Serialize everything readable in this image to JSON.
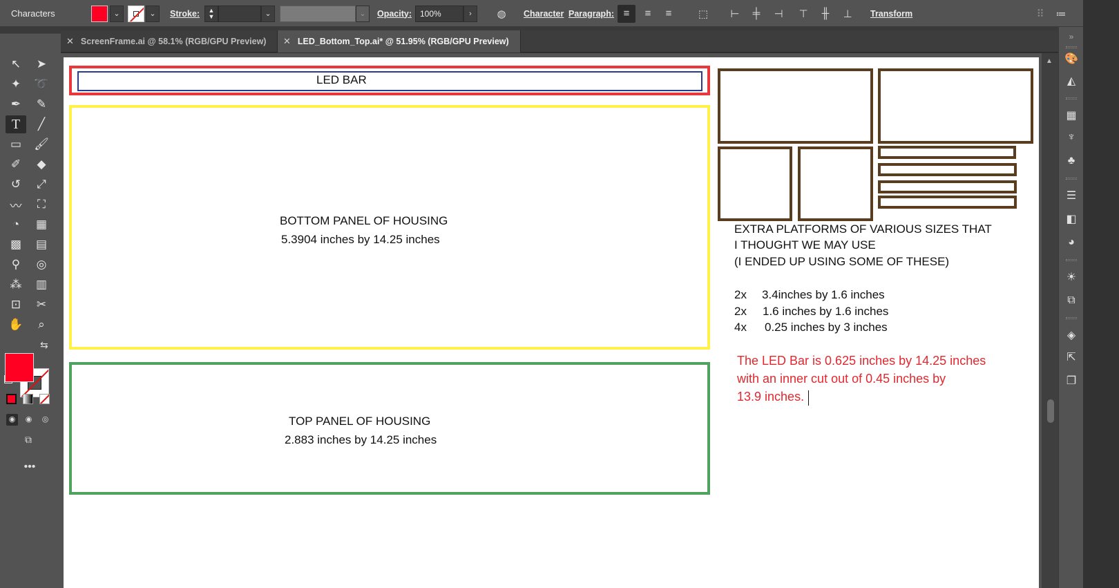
{
  "control_bar": {
    "panel_name": "Characters",
    "stroke_label": "Stroke:",
    "opacity_label": "Opacity:",
    "opacity_value": "100%",
    "character_link": "Character",
    "paragraph_link": "Paragraph:",
    "transform_link": "Transform",
    "fill_color": "#ff0022"
  },
  "tabs": [
    {
      "label": "ScreenFrame.ai @ 58.1% (RGB/GPU Preview)",
      "active": false
    },
    {
      "label": "LED_Bottom_Top.ai* @ 51.95% (RGB/GPU Preview)",
      "active": true
    }
  ],
  "artboard": {
    "led_bar": {
      "label": "LED BAR",
      "outer_color": "#e8383c",
      "inner_color": "#2a3a8c"
    },
    "bottom_panel": {
      "title": "BOTTOM PANEL OF HOUSING",
      "dims": "5.3904 inches by 14.25 inches",
      "color": "#fff04a"
    },
    "top_panel": {
      "title": "TOP PANEL OF HOUSING",
      "dims": "2.883 inches by 14.25 inches",
      "color": "#4fa35f"
    },
    "platforms": {
      "color": "#5a3d1f",
      "line1": "EXTRA PLATFORMS OF VARIOUS SIZES THAT",
      "line2": "I THOUGHT WE MAY USE",
      "line3": "(I ENDED UP USING SOME OF THESE)",
      "items": [
        {
          "qty": "2x",
          "size": "3.4inches by 1.6 inches"
        },
        {
          "qty": "2x",
          "size": "1.6 inches by 1.6 inches"
        },
        {
          "qty": "4x",
          "size": "0.25 inches by 3 inches"
        }
      ]
    },
    "note": {
      "line1": "The LED Bar is 0.625 inches by 14.25 inches",
      "line2": "with an inner cut out of 0.45 inches by",
      "line3": "13.9 inches.",
      "color": "#e0282e"
    }
  },
  "tools": [
    "selection-icon",
    "direct-selection-icon",
    "magic-wand-icon",
    "lasso-icon",
    "pen-icon",
    "curvature-icon",
    "type-icon",
    "line-segment-icon",
    "rectangle-icon",
    "paintbrush-icon",
    "shaper-icon",
    "eraser-icon",
    "rotate-icon",
    "scale-icon",
    "warp-icon",
    "free-transform-icon",
    "shape-builder-icon",
    "perspective-grid-icon",
    "mesh-icon",
    "gradient-icon",
    "eyedropper-icon",
    "blend-icon",
    "symbol-sprayer-icon",
    "column-graph-icon",
    "artboard-icon",
    "slice-icon",
    "hand-icon",
    "zoom-icon"
  ]
}
